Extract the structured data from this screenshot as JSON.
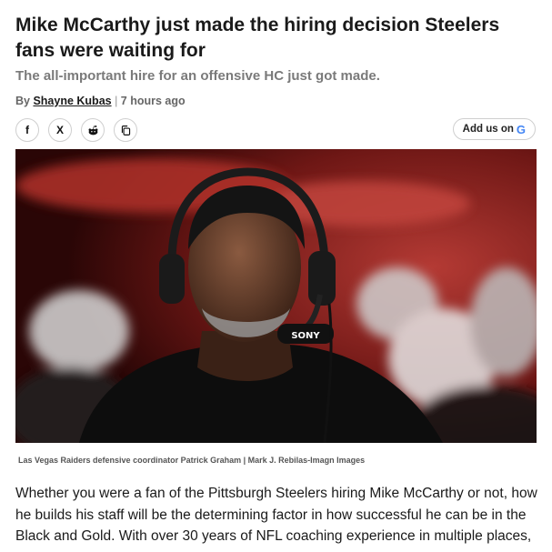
{
  "article": {
    "headline": "Mike McCarthy just made the hiring decision Steelers fans were waiting for",
    "subheadline": "The all-important hire for an offensive HC just got made.",
    "byline_prefix": "By ",
    "author": "Shayne Kubas",
    "byline_separator": " | ",
    "timestamp": "7 hours ago",
    "image_caption": "Las Vegas Raiders defensive coordinator Patrick Graham | Mark J. Rebilas-Imagn Images",
    "body": "Whether you were a fan of the Pittsburgh Steelers hiring Mike McCarthy or not, how he builds his staff will be the determining factor in how successful he can be in the Black and Gold. With over 30 years of NFL coaching experience in multiple places,",
    "headset_brand": "SONY"
  },
  "share": {
    "buttons": [
      {
        "icon": "facebook-icon",
        "glyph": "f"
      },
      {
        "icon": "x-icon",
        "glyph": "X"
      },
      {
        "icon": "reddit-icon",
        "glyph": ""
      },
      {
        "icon": "copy-link-icon",
        "glyph": ""
      }
    ]
  },
  "add_us": {
    "label": "Add us on",
    "logo_letter": "G"
  },
  "colors": {
    "headline": "#1a1a1a",
    "subhead": "#7a7a7a",
    "google_blue": "#4285F4"
  }
}
